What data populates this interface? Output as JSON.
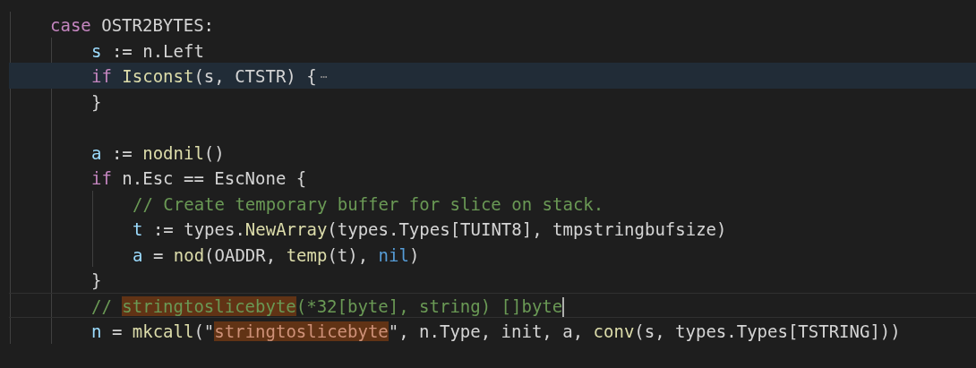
{
  "editor": {
    "lines": [
      {
        "kind": "code",
        "highlighted": false,
        "current": false,
        "tokens": [
          {
            "kind": "keyword",
            "text": "case"
          },
          {
            "kind": "plain",
            "text": " OSTR2BYTES:"
          }
        ],
        "children": [
          {
            "kind": "code",
            "highlighted": false,
            "current": false,
            "tokens": [
              {
                "kind": "var",
                "text": "s"
              },
              {
                "kind": "plain",
                "text": " := n.Left"
              }
            ]
          },
          {
            "kind": "code",
            "highlighted": true,
            "current": false,
            "tokens": [
              {
                "kind": "keyword",
                "text": "if "
              },
              {
                "kind": "func",
                "text": "Isconst"
              },
              {
                "kind": "plain",
                "text": "(s, CTSTR) {"
              },
              {
                "kind": "fold",
                "text": "⋯"
              }
            ]
          },
          {
            "kind": "code",
            "highlighted": false,
            "current": false,
            "tokens": [
              {
                "kind": "plain",
                "text": "}"
              }
            ]
          },
          {
            "kind": "blank"
          },
          {
            "kind": "code",
            "highlighted": false,
            "current": false,
            "tokens": [
              {
                "kind": "var",
                "text": "a"
              },
              {
                "kind": "plain",
                "text": " := "
              },
              {
                "kind": "func",
                "text": "nodnil"
              },
              {
                "kind": "plain",
                "text": "()"
              }
            ]
          },
          {
            "kind": "code",
            "highlighted": false,
            "current": false,
            "tokens": [
              {
                "kind": "keyword",
                "text": "if"
              },
              {
                "kind": "plain",
                "text": " n.Esc == EscNone {"
              }
            ],
            "children": [
              {
                "kind": "code",
                "highlighted": false,
                "current": false,
                "tokens": [
                  {
                    "kind": "comment",
                    "text": "// Create temporary buffer for slice on stack."
                  }
                ]
              },
              {
                "kind": "code",
                "highlighted": false,
                "current": false,
                "tokens": [
                  {
                    "kind": "var",
                    "text": "t"
                  },
                  {
                    "kind": "plain",
                    "text": " := types."
                  },
                  {
                    "kind": "func",
                    "text": "NewArray"
                  },
                  {
                    "kind": "plain",
                    "text": "(types.Types[TUINT8], tmpstringbufsize)"
                  }
                ]
              },
              {
                "kind": "code",
                "highlighted": false,
                "current": false,
                "tokens": [
                  {
                    "kind": "var",
                    "text": "a"
                  },
                  {
                    "kind": "plain",
                    "text": " = "
                  },
                  {
                    "kind": "func",
                    "text": "nod"
                  },
                  {
                    "kind": "plain",
                    "text": "(OADDR, "
                  },
                  {
                    "kind": "func",
                    "text": "temp"
                  },
                  {
                    "kind": "plain",
                    "text": "(t), "
                  },
                  {
                    "kind": "const",
                    "text": "nil"
                  },
                  {
                    "kind": "plain",
                    "text": ")"
                  }
                ]
              }
            ]
          },
          {
            "kind": "code",
            "highlighted": false,
            "current": false,
            "tokens": [
              {
                "kind": "plain",
                "text": "}"
              }
            ]
          },
          {
            "kind": "code",
            "highlighted": false,
            "current": true,
            "tokens": [
              {
                "kind": "comment",
                "text": "// "
              },
              {
                "kind": "comment-match",
                "text": "stringtoslicebyte"
              },
              {
                "kind": "comment",
                "text": "(*32[byte], string) []byte"
              }
            ]
          },
          {
            "kind": "code",
            "highlighted": false,
            "current": false,
            "tokens": [
              {
                "kind": "var",
                "text": "n"
              },
              {
                "kind": "plain",
                "text": " = "
              },
              {
                "kind": "func",
                "text": "mkcall"
              },
              {
                "kind": "plain",
                "text": "(\""
              },
              {
                "kind": "string-match",
                "text": "stringtoslicebyte"
              },
              {
                "kind": "plain",
                "text": "\", n.Type, init, a, "
              },
              {
                "kind": "func",
                "text": "conv"
              },
              {
                "kind": "plain",
                "text": "(s, types.Types[TSTRING]))"
              }
            ]
          }
        ]
      }
    ]
  }
}
